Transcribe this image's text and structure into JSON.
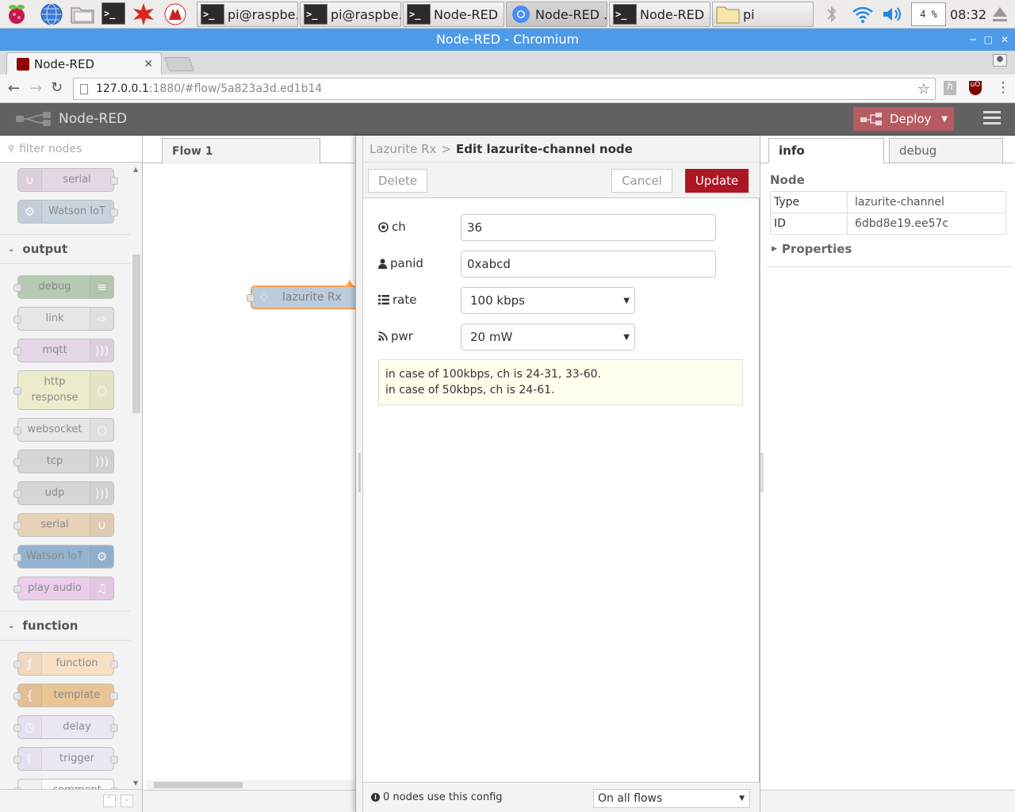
{
  "taskbar": {
    "buttons": [
      {
        "label": "pi@raspbe...",
        "type": "terminal"
      },
      {
        "label": "pi@raspbe...",
        "type": "terminal"
      },
      {
        "label": "Node-RED ...",
        "type": "terminal"
      },
      {
        "label": "Node-RED ...",
        "type": "chromium"
      },
      {
        "label": "Node-RED ...",
        "type": "terminal"
      },
      {
        "label": "pi",
        "type": "folder"
      }
    ],
    "cpu": "4 %",
    "clock": "08:32"
  },
  "window": {
    "title": "Node-RED - Chromium"
  },
  "browser": {
    "tab_title": "Node-RED",
    "url_host": "127.0.0.1",
    "url_path": ":1880/#flow/5a823a3d.ed1b14"
  },
  "app": {
    "name": "Node-RED",
    "deploy_label": "Deploy"
  },
  "palette": {
    "search_placeholder": "filter nodes",
    "top_nodes": [
      {
        "label": "serial",
        "color": "#d8bfd8"
      },
      {
        "label": "Watson IoT",
        "color": "#a6bbcf"
      }
    ],
    "categories": [
      {
        "label": "output",
        "nodes": [
          {
            "label": "debug",
            "color": "#87a980"
          },
          {
            "label": "link",
            "color": "#dddddd"
          },
          {
            "label": "mqtt",
            "color": "#d8bfd8"
          },
          {
            "label": "http response",
            "color": "#e7e7ae"
          },
          {
            "label": "websocket",
            "color": "#dddddd"
          },
          {
            "label": "tcp",
            "color": "#c0c0c0"
          },
          {
            "label": "udp",
            "color": "#c0c0c0"
          },
          {
            "label": "serial",
            "color": "#deb887"
          },
          {
            "label": "Watson IoT",
            "color": "#4682b4"
          },
          {
            "label": "play audio",
            "color": "#e5b0e5"
          }
        ]
      },
      {
        "label": "function",
        "nodes": [
          {
            "label": "function",
            "color": "#fdd0a2"
          },
          {
            "label": "template",
            "color": "#e2a04a"
          },
          {
            "label": "delay",
            "color": "#e6e0f8"
          },
          {
            "label": "trigger",
            "color": "#e6e0f8"
          },
          {
            "label": "comment",
            "color": "#ffffff"
          }
        ]
      }
    ]
  },
  "workspace": {
    "flow_tab": "Flow 1",
    "node_label": "lazurite Rx"
  },
  "editor": {
    "breadcrumb_parent": "Lazurite Rx",
    "breadcrumb_sep": ">",
    "title": "Edit lazurite-channel node",
    "delete_label": "Delete",
    "cancel_label": "Cancel",
    "update_label": "Update",
    "fields": {
      "ch": {
        "label": "ch",
        "value": "36"
      },
      "panid": {
        "label": "panid",
        "value": "0xabcd"
      },
      "rate": {
        "label": "rate",
        "value": "100 kbps"
      },
      "pwr": {
        "label": "pwr",
        "value": "20 mW"
      }
    },
    "tip_line1": "in case of 100kbps, ch is 24-31, 33-60.",
    "tip_line2": "in case of 50kbps, ch is 24-61.",
    "footer_text": "0 nodes use this config",
    "scope_value": "On all flows"
  },
  "sidebar": {
    "tabs": [
      "info",
      "debug"
    ],
    "section_title": "Node",
    "type_label": "Type",
    "type_value": "lazurite-channel",
    "id_label": "ID",
    "id_value": "6dbd8e19.ee57c",
    "properties_label": "Properties"
  }
}
